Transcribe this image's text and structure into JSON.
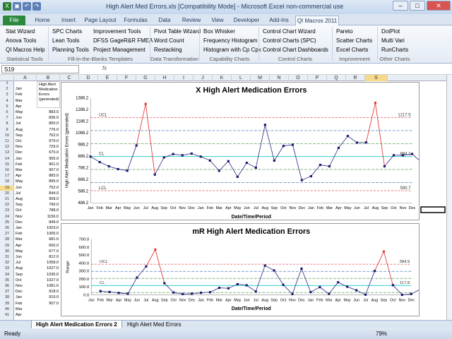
{
  "window": {
    "title": "High Alert Med Errors.xls [Compatibility Mode] - Microsoft Excel non-commercial use"
  },
  "tabs": [
    "File",
    "Home",
    "Insert",
    "Page Layout",
    "Formulas",
    "Data",
    "Review",
    "View",
    "Developer",
    "Add-Ins",
    "QI Macros 2011"
  ],
  "ribbon": {
    "col1": [
      "Stat Wizard",
      "Anova Tools",
      "QI Macros Help"
    ],
    "col2": [
      "SPC Charts",
      "Lean Tools",
      "Planning Tools"
    ],
    "col3": [
      "Improvement Tools",
      "DFSS GageR&R FMEA",
      "Project Management"
    ],
    "col4": [
      "Pivot Table Wizard",
      "Word Count",
      "Restacking"
    ],
    "col5": [
      "Box Whisker",
      "Frequency Histogram",
      "Histogram with Cp Cpk"
    ],
    "col6": [
      "Control Chart Wizard",
      "Control Charts (SPC)",
      "Control Chart Dashboards"
    ],
    "col7": [
      "Pareto",
      "Scatter Charts",
      "Excel Charts"
    ],
    "col8": [
      "DotPlot",
      "Multi Vari",
      "RunCharts"
    ],
    "groups": [
      "Statistical Tools",
      "Fill-in-the-Blanks Templates",
      "Data Transformation",
      "Capability Charts",
      "Control Charts",
      "Improvement Charts",
      "Other Charts"
    ]
  },
  "formula": {
    "namebox": "S19",
    "fx": "fx"
  },
  "columns": [
    "A",
    "B",
    "C",
    "D",
    "E",
    "F",
    "G",
    "H",
    "I",
    "J",
    "K",
    "L",
    "M",
    "N",
    "O",
    "P",
    "Q",
    "R",
    "S"
  ],
  "sheet": {
    "b_header": "High Alert Medication Errors (generated)",
    "months": [
      "Jan",
      "Feb",
      "Mar",
      "Apr",
      "May",
      "Jun",
      "Jul",
      "Aug",
      "Sep",
      "Oct",
      "Nov",
      "Dec",
      "Jan",
      "Feb",
      "Mar",
      "Apr",
      "May",
      "Jun",
      "Jul",
      "Aug",
      "Sep",
      "Oct",
      "Nov",
      "Dec",
      "Jan",
      "Feb",
      "Mar",
      "Apr",
      "May",
      "Jun",
      "Jul",
      "Aug",
      "Sep",
      "Oct",
      "Nov",
      "Dec",
      "Jan",
      "Feb",
      "Mar",
      "Apr",
      "May",
      "Jun",
      "Jul",
      "Aug",
      "Sep",
      "Oct",
      "Nov",
      "Dec"
    ],
    "values": [
      "883.0",
      "836.0",
      "800.0",
      "776.0",
      "762.0",
      "979.0",
      "729.0",
      "670.0",
      "955.0",
      "901.0",
      "907.0",
      "883.0",
      "895.0",
      "752.0",
      "844.0",
      "958.0",
      "790.0",
      "788.0",
      "1156.0",
      "849.0",
      "1003.0",
      "1005.0",
      "681.0",
      "650.0",
      "677.0",
      "812.0",
      "1058.0",
      "1027.0",
      "1036.0",
      "1027.0",
      "1081.0",
      "918.0",
      "919.0",
      "907.0"
    ],
    "rows": [
      "1",
      "2",
      "3",
      "4",
      "5",
      "6",
      "7",
      "8",
      "9",
      "10",
      "11",
      "12",
      "13",
      "14",
      "15",
      "16",
      "17",
      "18",
      "19",
      "20",
      "21",
      "22",
      "23",
      "24",
      "25",
      "26",
      "27",
      "28",
      "29",
      "30",
      "31",
      "32",
      "33",
      "34",
      "35",
      "36",
      "37",
      "38",
      "39",
      "40",
      "41"
    ]
  },
  "chart_data": [
    {
      "type": "line",
      "title": "X High Alert Medication Errors",
      "xlabel": "Date/Time/Period",
      "ylabel": "High Alert Medication Errors (generated)",
      "ylim": [
        486.2,
        1386.2
      ],
      "yticks": [
        "1386.2",
        "1286.2",
        "1186.2",
        "1086.2",
        "986.2",
        "886.2",
        "786.2",
        "686.2",
        "586.2",
        "486.2"
      ],
      "x": [
        "Jan",
        "Feb",
        "Mar",
        "Apr",
        "May",
        "Jun",
        "Jul",
        "Aug",
        "Sep",
        "Oct",
        "Nov",
        "Dec",
        "Jan",
        "Feb",
        "Mar",
        "Apr",
        "May",
        "Jun",
        "Jul",
        "Aug",
        "Sep",
        "Oct",
        "Nov",
        "Dec",
        "Jan",
        "Feb",
        "Mar",
        "Apr",
        "May",
        "Jun",
        "Jul",
        "Aug",
        "Sep",
        "Oct",
        "Nov",
        "Dec"
      ],
      "values": [
        883,
        836,
        800,
        776,
        762,
        979,
        1336,
        729,
        876,
        905,
        895,
        909,
        883,
        850,
        762,
        844,
        710,
        830,
        788,
        1156,
        849,
        975,
        985,
        681,
        715,
        812,
        800,
        958,
        1060,
        1003,
        1005,
        1345,
        800,
        895,
        895,
        906,
        836
      ],
      "ucl": 1217.5,
      "cl": 884.1,
      "lcl": 590.7,
      "ucl_label": "UCL",
      "cl_label": "CL",
      "lcl_label": "LCL",
      "ucl_text": "1217.5",
      "cl_text": "884.1",
      "lcl_text": "590.7",
      "colors": {
        "line": "#3c3c8c",
        "out": "#e23b3b",
        "ucl": "#e05050",
        "cl": "#33cccc",
        "sigma": "#3a8a3a"
      }
    },
    {
      "type": "line",
      "title": "mR High Alert Medication Errors",
      "xlabel": "Date/Time/Period",
      "ylabel": "Range",
      "ylim": [
        0,
        700
      ],
      "yticks": [
        "700.0",
        "600.0",
        "500.0",
        "400.0",
        "300.0",
        "200.0",
        "100.0",
        "0.0"
      ],
      "x": [
        "Jan",
        "Feb",
        "Mar",
        "Apr",
        "May",
        "Jun",
        "Jul",
        "Aug",
        "Sep",
        "Oct",
        "Nov",
        "Dec",
        "Jan",
        "Feb",
        "Mar",
        "Apr",
        "May",
        "Jun",
        "Jul",
        "Aug",
        "Sep",
        "Oct",
        "Nov",
        "Dec",
        "Jan",
        "Feb",
        "Mar",
        "Apr",
        "May",
        "Jun",
        "Jul",
        "Aug",
        "Sep",
        "Oct",
        "Nov",
        "Dec"
      ],
      "values": [
        null,
        47,
        36,
        24,
        14,
        217,
        357,
        570,
        147,
        29,
        10,
        14,
        26,
        33,
        88,
        82,
        134,
        120,
        42,
        368,
        307,
        126,
        10,
        330,
        34,
        97,
        12,
        158,
        102,
        57,
        2,
        300,
        545,
        122,
        0,
        11,
        70
      ],
      "ucl": 384.9,
      "cl": 117.8,
      "ucl_label": "UCL",
      "cl_label": "CL",
      "ucl_text": "384.9",
      "cl_text": "117.8"
    }
  ],
  "sheet_tabs": [
    "High Alert Medication Errors 2",
    "High Alert Med Errors"
  ],
  "status": {
    "ready": "Ready",
    "zoom": "79%"
  }
}
